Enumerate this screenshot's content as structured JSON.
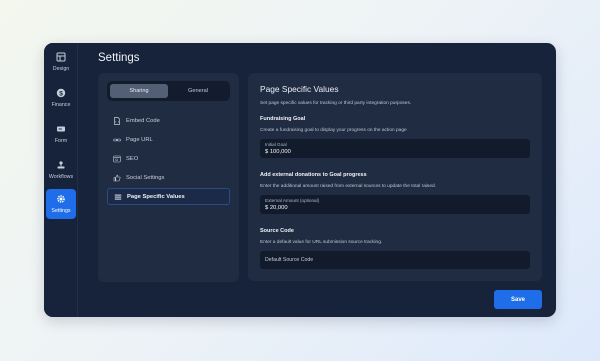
{
  "sidebar": {
    "items": [
      {
        "label": "Design",
        "icon": "layout-icon",
        "active": false
      },
      {
        "label": "Finance",
        "icon": "dollar-icon",
        "active": false
      },
      {
        "label": "Form",
        "icon": "form-icon",
        "active": false
      },
      {
        "label": "Workflows",
        "icon": "workflow-icon",
        "active": false
      },
      {
        "label": "Settings",
        "icon": "gear-icon",
        "active": true
      }
    ]
  },
  "page": {
    "title": "Settings"
  },
  "tabs": [
    {
      "label": "Sharing",
      "active": true
    },
    {
      "label": "General",
      "active": false
    }
  ],
  "nav": {
    "items": [
      {
        "label": "Embed Code",
        "icon": "code-file-icon",
        "active": false
      },
      {
        "label": "Page URL",
        "icon": "link-icon",
        "active": false
      },
      {
        "label": "SEO",
        "icon": "seo-icon",
        "active": false
      },
      {
        "label": "Social Settings",
        "icon": "thumbs-up-icon",
        "active": false
      },
      {
        "label": "Page Specific Values",
        "icon": "list-icon",
        "active": true
      }
    ]
  },
  "content": {
    "heading": "Page Specific Values",
    "description": "Set page specific values for tracking or third party integration purposes.",
    "goal": {
      "title": "Fundraising Goal",
      "description": "Create a fundraising goal to display your progress on the action page",
      "field_label": "Initial Goal",
      "field_value": "$ 100,000"
    },
    "external": {
      "title": "Add external donations to Goal progress",
      "description": "Enter the additional amount raised from external sources to update the total raised.",
      "field_label": "External Amount (optional)",
      "field_value": "$ 20,000"
    },
    "source": {
      "title": "Source Code",
      "description": "Enter a default value for URL submission source tracking.",
      "placeholder": "Default Source Code"
    }
  },
  "footer": {
    "save_label": "Save"
  },
  "colors": {
    "accent": "#1f6de8",
    "panel": "#202c42",
    "background": "#17233a"
  }
}
